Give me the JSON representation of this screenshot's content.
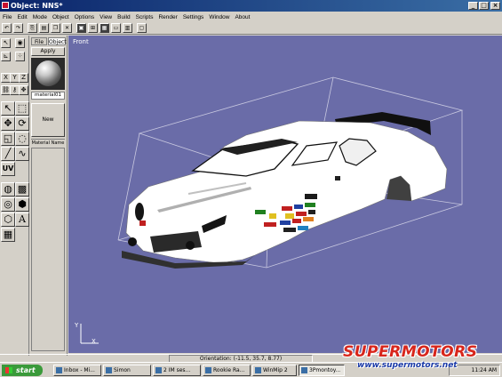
{
  "window": {
    "title": "Object: NNS*"
  },
  "menu": [
    "File",
    "Edit",
    "Mode",
    "Object",
    "Options",
    "View",
    "Build",
    "Scripts",
    "Render",
    "Settings",
    "Window",
    "About"
  ],
  "panel": {
    "tabs": [
      "File",
      "Object"
    ],
    "apply_label": "Apply",
    "material_name": "material01",
    "new_label": "New",
    "material_name_label": "Material Name"
  },
  "left_tools": {
    "uv_label": "UV",
    "axis_labels": [
      "X",
      "Y",
      "Z"
    ],
    "text_tool": "A"
  },
  "viewport": {
    "label": "Front",
    "axis_y": "Y",
    "axis_x": "X",
    "background_color": "#6a6ca8"
  },
  "status": {
    "text": "Orientation: (-11.5, 35.7, 8.77)"
  },
  "taskbar": {
    "start_label": "start",
    "tasks": [
      "Inbox - Mi...",
      "Simon",
      "2 IM ses...",
      "Rookie Ra...",
      "WinMip 2",
      "3Pmontoy..."
    ],
    "clock": "11:24 AM"
  },
  "watermark": {
    "line1": "SUPERMOTORS",
    "line2": "www.supermotors.net"
  }
}
